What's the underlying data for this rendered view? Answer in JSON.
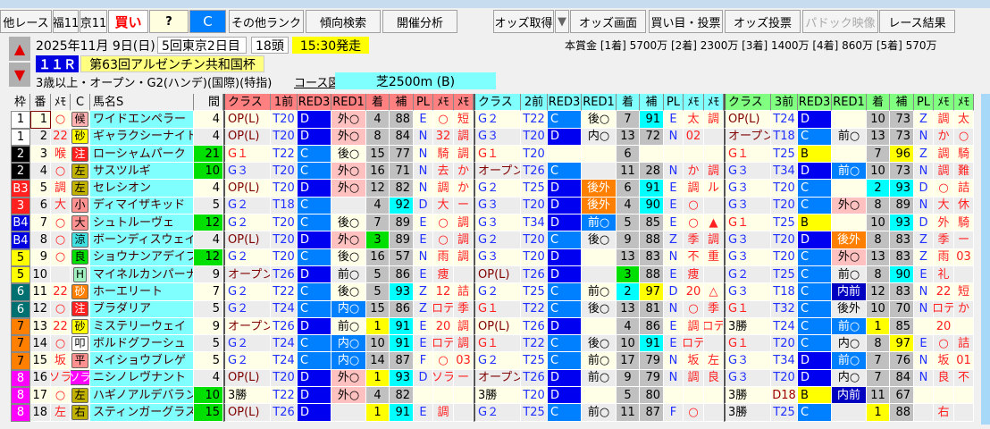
{
  "toolbar": {
    "buttons": [
      "他レース",
      "福11",
      "京11",
      "買い",
      "?",
      "C",
      "その他ランク",
      "傾向検索",
      "開催分析",
      "オッズ取得",
      "▼",
      "オッズ画面",
      "買い目・投票",
      "オッズ投票",
      "パドック映像",
      "レース結果"
    ]
  },
  "race": {
    "date": "2025年11月 9日(日)",
    "kai": "5回東京2日目",
    "heads": "18頭",
    "start": "15:30発走",
    "rno": "１１Ｒ",
    "name": "第63回アルゼンチン共和国杯",
    "cond": "3歳以上・オープン・G2(ハンデ)(国際)(特指)",
    "course_label": "コース図",
    "course": "芝2500m (B)",
    "prize": "本賞金 [1着] 5700万 [2着] 2300万 [3着] 1400万 [4着] 860万 [5着] 570万"
  },
  "headers": {
    "left": [
      "枠",
      "番",
      "ﾒﾓ",
      "C",
      "馬名S",
      "間"
    ],
    "b1": [
      "クラス",
      "1前",
      "RED3",
      "RED1",
      "着",
      "補",
      "PL",
      "ﾒﾓ",
      "ﾒﾓ"
    ],
    "b2": [
      "クラス",
      "2前",
      "RED3",
      "RED1",
      "着",
      "補",
      "PL",
      "ﾒﾓ",
      "ﾒﾓ"
    ],
    "b3": [
      "クラス",
      "3前",
      "RED3",
      "RED1",
      "着",
      "補",
      "PL",
      "ﾒﾓ",
      "ﾒﾓ"
    ]
  },
  "colors": {
    "waku": {
      "1": "#ffffff",
      "2": "#000000",
      "3": "#ff2020",
      "4": "#0000e0",
      "5": "#ffff00",
      "6": "#007070",
      "7": "#ff8000",
      "8": "#ff00ff"
    }
  },
  "horses": [
    {
      "waku": 1,
      "wl": "1",
      "no": "1",
      "mark": "○",
      "c": "候",
      "cbg": "#ffb0b0",
      "name": "ワイドエンペラー",
      "kan": "4",
      "kg": false,
      "b": [
        [
          "OP(L)",
          "T20",
          "D",
          "外○",
          "p",
          "4",
          "",
          "88",
          "",
          "E",
          "○",
          "短"
        ],
        [
          "G２",
          "T22",
          "C",
          "後○",
          "",
          "7",
          "",
          "91",
          "c",
          "E",
          "太",
          "調"
        ],
        [
          "OP(L)",
          "T24",
          "D",
          "",
          "",
          "10",
          "",
          "73",
          "",
          "Z",
          "調",
          "太"
        ]
      ]
    },
    {
      "waku": 1,
      "wl": "1",
      "no": "2",
      "mark": "22",
      "c": "砂",
      "cbg": "#ffff00",
      "name": "ギャラクシーナイト",
      "kan": "4",
      "kg": false,
      "b": [
        [
          "OP(L)",
          "T20",
          "D",
          "外○",
          "p",
          "8",
          "",
          "84",
          "",
          "N",
          "32",
          "調"
        ],
        [
          "G３",
          "T20",
          "D",
          "内○",
          "",
          "13",
          "",
          "72",
          "",
          "N",
          "02",
          ""
        ],
        [
          "オープン",
          "T18",
          "C",
          "前○",
          "",
          "13",
          "",
          "73",
          "",
          "N",
          "か",
          "○"
        ]
      ]
    },
    {
      "waku": 2,
      "wl": "2",
      "no": "3",
      "mark": "喉",
      "c": "注",
      "cbg": "#ff2020",
      "name": "ローシャムパーク",
      "kan": "21",
      "kg": true,
      "b": [
        [
          "G１",
          "T22",
          "C",
          "後○",
          "",
          "15",
          "",
          "77",
          "",
          "N",
          "騎",
          "調"
        ],
        [
          "G１",
          "T20",
          "",
          "",
          "",
          "6",
          "",
          "",
          "",
          "",
          "",
          ""
        ],
        [
          "G１",
          "T25",
          "B",
          "",
          "",
          "7",
          "",
          "96",
          "y",
          "Z",
          "調",
          "騎"
        ]
      ]
    },
    {
      "waku": 2,
      "wl": "2",
      "no": "4",
      "mark": "○",
      "c": "左",
      "cbg": "#c0b000",
      "name": "サスツルギ",
      "kan": "10",
      "kg": true,
      "b": [
        [
          "G３",
          "T20",
          "C",
          "外○",
          "p",
          "16",
          "",
          "71",
          "",
          "N",
          "去",
          "か"
        ],
        [
          "オープン",
          "T26",
          "C",
          "",
          "",
          "11",
          "",
          "28",
          "",
          "N",
          "か",
          "調"
        ],
        [
          "G３",
          "T34",
          "D",
          "前○",
          "b",
          "10",
          "",
          "73",
          "",
          "N",
          "調",
          "難"
        ]
      ]
    },
    {
      "waku": 3,
      "wl": "B3",
      "no": "5",
      "mark": "調",
      "c": "左",
      "cbg": "#c0b000",
      "name": "セレシオン",
      "kan": "4",
      "kg": false,
      "b": [
        [
          "OP(L)",
          "T20",
          "D",
          "外○",
          "p",
          "12",
          "",
          "82",
          "",
          "N",
          "調",
          "か"
        ],
        [
          "G２",
          "T25",
          "D",
          "後外",
          "o",
          "6",
          "",
          "91",
          "c",
          "E",
          "調",
          "ル"
        ],
        [
          "G３",
          "T20",
          "C",
          "",
          "",
          "2",
          "c",
          "93",
          "c",
          "D",
          "○",
          "詰"
        ]
      ]
    },
    {
      "waku": 3,
      "wl": "3",
      "no": "6",
      "mark": "大",
      "c": "小",
      "cbg": "#ff9090",
      "name": "ディマイザキッド",
      "kan": "5",
      "kg": false,
      "b": [
        [
          "G２",
          "T18",
          "C",
          "",
          "",
          "4",
          "",
          "92",
          "c",
          "D",
          "大",
          "ー"
        ],
        [
          "G３",
          "T20",
          "D",
          "後外",
          "o",
          "4",
          "",
          "90",
          "c",
          "E",
          "○",
          ""
        ],
        [
          "G３",
          "T20",
          "C",
          "外○",
          "p",
          "8",
          "",
          "89",
          "",
          "N",
          "大",
          "休"
        ]
      ]
    },
    {
      "waku": 4,
      "wl": "B4",
      "no": "7",
      "mark": "○",
      "c": "大",
      "cbg": "#ff9090",
      "name": "シュトルーヴェ",
      "kan": "12",
      "kg": true,
      "b": [
        [
          "G２",
          "T20",
          "C",
          "後○",
          "",
          "7",
          "",
          "89",
          "",
          "E",
          "○",
          "調"
        ],
        [
          "G３",
          "T34",
          "D",
          "前○",
          "b",
          "5",
          "",
          "85",
          "",
          "E",
          "○",
          "▲"
        ],
        [
          "G１",
          "T25",
          "B",
          "",
          "",
          "10",
          "",
          "93",
          "c",
          "D",
          "外",
          "騎"
        ]
      ]
    },
    {
      "waku": 4,
      "wl": "B4",
      "no": "8",
      "mark": "○",
      "c": "涼",
      "cbg": "#40e0e0",
      "name": "ボーンディスウェイ",
      "kan": "4",
      "kg": false,
      "b": [
        [
          "OP(L)",
          "T20",
          "D",
          "外○",
          "p",
          "3",
          "g",
          "89",
          "",
          "E",
          "○",
          "調"
        ],
        [
          "G２",
          "T20",
          "C",
          "後○",
          "",
          "9",
          "",
          "88",
          "",
          "Z",
          "季",
          "調"
        ],
        [
          "G３",
          "T20",
          "D",
          "後外",
          "o",
          "8",
          "",
          "83",
          "",
          "Z",
          "季",
          "ー"
        ]
      ]
    },
    {
      "waku": 5,
      "wl": "5",
      "no": "9",
      "mark": "○",
      "c": "良",
      "cbg": "#00e000",
      "name": "ショウナンアデイブ",
      "kan": "12",
      "kg": true,
      "b": [
        [
          "G２",
          "T20",
          "C",
          "後○",
          "",
          "16",
          "",
          "57",
          "",
          "N",
          "雨",
          "調"
        ],
        [
          "G３",
          "T20",
          "D",
          "",
          "",
          "13",
          "",
          "83",
          "",
          "N",
          "不",
          "重"
        ],
        [
          "G３",
          "T20",
          "C",
          "外○",
          "p",
          "13",
          "",
          "83",
          "",
          "Z",
          "雨",
          "03"
        ]
      ]
    },
    {
      "waku": 5,
      "wl": "5",
      "no": "10",
      "mark": "",
      "c": "H",
      "cbg": "#a0f0c0",
      "name": "マイネルカンパーナ",
      "kan": "9",
      "kg": false,
      "b": [
        [
          "オープン",
          "T26",
          "D",
          "前○",
          "",
          "5",
          "",
          "86",
          "",
          "E",
          "痩",
          ""
        ],
        [
          "OP(L)",
          "T26",
          "D",
          "",
          "",
          "3",
          "g",
          "88",
          "",
          "E",
          "痩",
          ""
        ],
        [
          "G２",
          "T25",
          "C",
          "前○",
          "",
          "8",
          "",
          "90",
          "c",
          "E",
          "礼",
          ""
        ]
      ]
    },
    {
      "waku": 6,
      "wl": "6",
      "no": "11",
      "mark": "22",
      "c": "砂",
      "cbg": "#ff8000",
      "name": "ホーエリート",
      "kan": "7",
      "kg": false,
      "b": [
        [
          "G２",
          "T22",
          "C",
          "後○",
          "",
          "5",
          "",
          "93",
          "c",
          "Z",
          "12",
          "詰"
        ],
        [
          "G２",
          "T25",
          "C",
          "前○",
          "",
          "2",
          "c",
          "97",
          "y",
          "D",
          "20",
          "△"
        ],
        [
          "G３",
          "T18",
          "C",
          "内前",
          "n",
          "12",
          "",
          "83",
          "",
          "N",
          "22",
          "短"
        ]
      ]
    },
    {
      "waku": 6,
      "wl": "6",
      "no": "12",
      "mark": "○",
      "c": "注",
      "cbg": "#ff2020",
      "name": "ブラダリア",
      "kan": "5",
      "kg": false,
      "b": [
        [
          "G２",
          "T24",
          "C",
          "内○",
          "b",
          "15",
          "",
          "86",
          "",
          "Z",
          "ロテ",
          "季"
        ],
        [
          "G１",
          "T22",
          "C",
          "後○",
          "",
          "13",
          "",
          "81",
          "",
          "N",
          "○",
          "季"
        ],
        [
          "G１",
          "T32",
          "C",
          "後外",
          "",
          "10",
          "",
          "70",
          "",
          "N",
          "ロテ",
          "か"
        ]
      ]
    },
    {
      "waku": 7,
      "wl": "7",
      "no": "13",
      "mark": "22",
      "c": "砂",
      "cbg": "#ffff00",
      "name": "ミステリーウェイ",
      "kan": "9",
      "kg": false,
      "b": [
        [
          "オープン",
          "T26",
          "D",
          "前○",
          "",
          "1",
          "y",
          "91",
          "c",
          "E",
          "20",
          "調"
        ],
        [
          "OP(L)",
          "T26",
          "D",
          "",
          "",
          "4",
          "",
          "86",
          "",
          "E",
          "調",
          "ロテ"
        ],
        [
          "3勝",
          "T24",
          "C",
          "前○",
          "b",
          "1",
          "y",
          "85",
          "",
          "",
          "20",
          ""
        ]
      ]
    },
    {
      "waku": 7,
      "wl": "7",
      "no": "14",
      "mark": "○",
      "c": "叩",
      "cbg": "#ffffff",
      "name": "ボルドグフーシュ",
      "kan": "5",
      "kg": false,
      "b": [
        [
          "G２",
          "T24",
          "C",
          "内○",
          "b",
          "10",
          "",
          "91",
          "c",
          "E",
          "ロテ",
          "調"
        ],
        [
          "G１",
          "T22",
          "C",
          "後○",
          "",
          "10",
          "",
          "91",
          "c",
          "E",
          "ロテ",
          ""
        ],
        [
          "G１",
          "T20",
          "C",
          "内○",
          "",
          "8",
          "",
          "97",
          "y",
          "E",
          "○",
          "詰"
        ]
      ]
    },
    {
      "waku": 7,
      "wl": "7",
      "no": "15",
      "mark": "坂",
      "c": "平",
      "cbg": "#ff9090",
      "name": "メイショウブレゲ",
      "kan": "5",
      "kg": false,
      "b": [
        [
          "G２",
          "T24",
          "C",
          "内○",
          "b",
          "14",
          "",
          "87",
          "",
          "F",
          "○",
          "03"
        ],
        [
          "G２",
          "T25",
          "C",
          "前○",
          "",
          "17",
          "",
          "79",
          "",
          "N",
          "坂",
          "左"
        ],
        [
          "G３",
          "T34",
          "D",
          "前○",
          "b",
          "7",
          "",
          "76",
          "",
          "N",
          "坂",
          "01"
        ]
      ]
    },
    {
      "waku": 8,
      "wl": "8",
      "no": "16",
      "mark": "ソラ",
      "c": "ソラ",
      "cbg": "#ff00ff",
      "name": "ニシノレヴナント",
      "kan": "4",
      "kg": false,
      "b": [
        [
          "OP(L)",
          "T20",
          "D",
          "外○",
          "p",
          "1",
          "y",
          "93",
          "c",
          "D",
          "ソラ",
          "ー"
        ],
        [
          "オープン",
          "T26",
          "D",
          "前○",
          "",
          "9",
          "",
          "79",
          "",
          "N",
          "調",
          "良"
        ],
        [
          "G３",
          "T20",
          "D",
          "内○",
          "",
          "7",
          "",
          "84",
          "",
          "N",
          "良",
          "不"
        ]
      ]
    },
    {
      "waku": 8,
      "wl": "8",
      "no": "17",
      "mark": "○",
      "c": "左",
      "cbg": "#c0b000",
      "name": "ハギノアルデバラン",
      "kan": "10",
      "kg": true,
      "b": [
        [
          "3勝",
          "T22",
          "D",
          "外○",
          "p",
          "4",
          "",
          "82",
          "",
          "",
          "",
          ""
        ],
        [
          "3勝",
          "T20",
          "D",
          "",
          "",
          "5",
          "",
          "80",
          "",
          "",
          "",
          ""
        ],
        [
          "3勝",
          "D18",
          "B",
          "内前",
          "n",
          "11",
          "",
          "67",
          "",
          "",
          "",
          ""
        ]
      ]
    },
    {
      "waku": 8,
      "wl": "8",
      "no": "18",
      "mark": "左",
      "c": "右",
      "cbg": "#c0b000",
      "name": "スティンガーグラス",
      "kan": "15",
      "kg": true,
      "b": [
        [
          "OP(L)",
          "T26",
          "D",
          "",
          "",
          "1",
          "y",
          "91",
          "c",
          "E",
          "調",
          ""
        ],
        [
          "G２",
          "T25",
          "C",
          "前○",
          "",
          "11",
          "",
          "87",
          "",
          "F",
          "○",
          ""
        ],
        [
          "3勝",
          "T25",
          "C",
          "",
          "",
          "1",
          "y",
          "88",
          "",
          "",
          "右",
          ""
        ]
      ]
    }
  ]
}
